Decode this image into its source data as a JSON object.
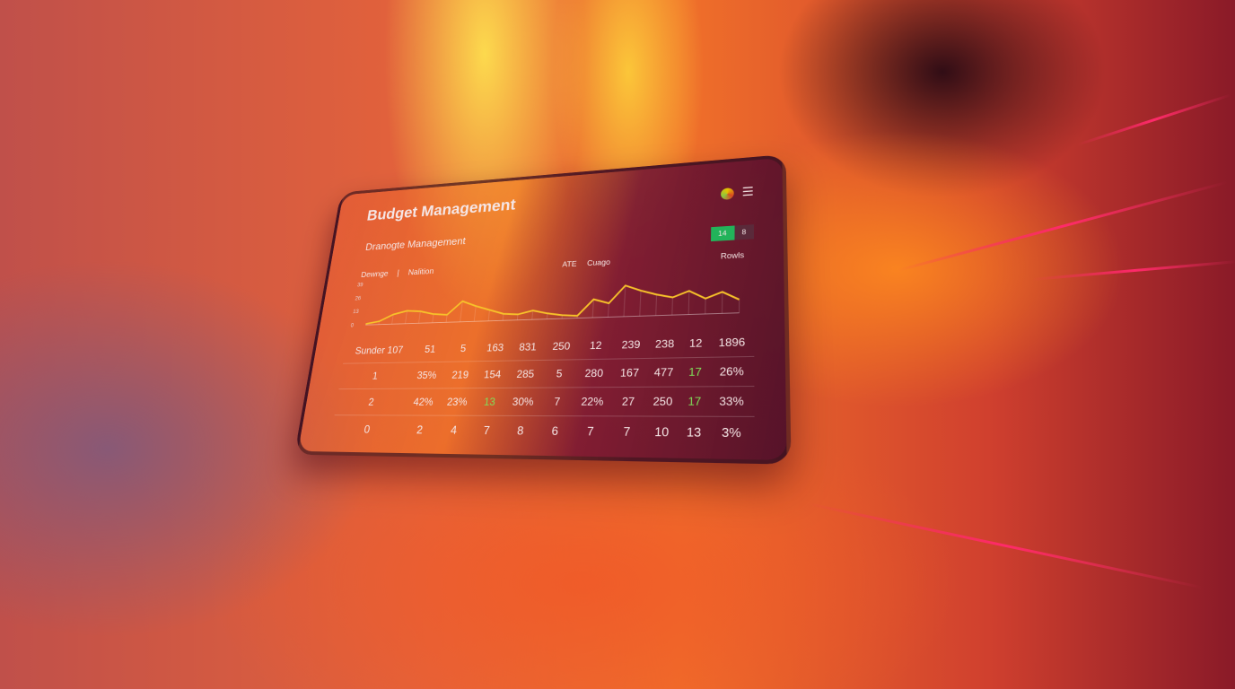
{
  "dashboard": {
    "title": "Budget Management",
    "subtitle": "Dranogte Management",
    "tabs": [
      "Dewnge",
      "|",
      "Nalition"
    ],
    "legend": [
      "ATE",
      "Cuago"
    ],
    "legend_right": "Rowls",
    "toggle": [
      "14",
      "8"
    ],
    "icons": {
      "logo": "logo-icon",
      "menu": "hamburger-menu-icon"
    },
    "menu_glyph": "☰",
    "accent": "#22b35a",
    "line_color": "#f7c22a"
  },
  "chart_data": {
    "type": "line",
    "yticks": [
      "0",
      "13",
      "26",
      "39"
    ],
    "ylim": [
      0,
      39
    ],
    "series": [
      {
        "name": "ATE",
        "values": [
          1,
          3,
          9,
          12,
          11,
          8,
          7,
          19,
          14,
          10,
          6,
          5,
          8,
          5,
          3,
          2,
          16,
          12,
          27,
          22,
          18,
          15,
          20,
          13,
          18,
          11
        ]
      }
    ]
  },
  "table": {
    "rows": [
      [
        "Sunder 107",
        "51",
        "5",
        "163",
        "831",
        "250",
        "12",
        "239",
        "238",
        "12",
        "1896"
      ],
      [
        "1",
        "35%",
        "219",
        "154",
        "285",
        "5",
        "280",
        "167",
        "477",
        "17",
        "26%"
      ],
      [
        "2",
        "42%",
        "23%",
        "13",
        "30%",
        "7",
        "22%",
        "27",
        "250",
        "17",
        "33%"
      ]
    ],
    "footer": [
      "0",
      "2",
      "4",
      "7",
      "8",
      "6",
      "7",
      "7",
      "10",
      "13",
      "3%"
    ]
  }
}
